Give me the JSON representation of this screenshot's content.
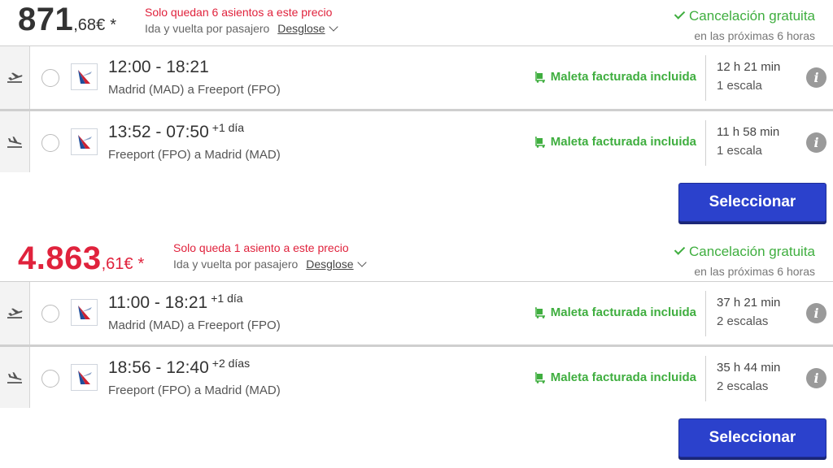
{
  "offers": [
    {
      "price_int": "871",
      "price_dec": ",68",
      "currency": "€",
      "star": "*",
      "seats_left": "Solo quedan 6 asientos a este precio",
      "fare_note": "Ida y vuelta por pasajero",
      "breakdown_link": "Desglose",
      "cancel_label": "Cancelación gratuita",
      "cancel_sub": "en las próximas 6 horas",
      "segments": [
        {
          "times": "12:00 - 18:21",
          "plus_day": "",
          "route": "Madrid (MAD) a Freeport (FPO)",
          "baggage": "Maleta facturada incluida",
          "duration": "12 h 21 min",
          "stops": "1 escala"
        },
        {
          "times": "13:52 - 07:50",
          "plus_day": "+1 día",
          "route": "Freeport (FPO) a Madrid (MAD)",
          "baggage": "Maleta facturada incluida",
          "duration": "11 h 58 min",
          "stops": "1 escala"
        }
      ],
      "select_label": "Seleccionar"
    },
    {
      "price_int": "4.863",
      "price_dec": ",61",
      "currency": "€",
      "star": "*",
      "seats_left": "Solo queda 1 asiento a este precio",
      "fare_note": "Ida y vuelta por pasajero",
      "breakdown_link": "Desglose",
      "cancel_label": "Cancelación gratuita",
      "cancel_sub": "en las próximas 6 horas",
      "segments": [
        {
          "times": "11:00 - 18:21",
          "plus_day": "+1 día",
          "route": "Madrid (MAD) a Freeport (FPO)",
          "baggage": "Maleta facturada incluida",
          "duration": "37 h 21 min",
          "stops": "2 escalas"
        },
        {
          "times": "18:56 - 12:40",
          "plus_day": "+2 días",
          "route": "Freeport (FPO) a Madrid (MAD)",
          "baggage": "Maleta facturada incluida",
          "duration": "35 h 44 min",
          "stops": "2 escalas"
        }
      ],
      "select_label": "Seleccionar"
    }
  ],
  "colors": {
    "price_alert": "#e0223c",
    "green": "#3fae3f",
    "select_button": "#2b41cc",
    "info_icon": "#9a9a9a"
  },
  "icons": {
    "outbound": "plane-takeoff-icon",
    "return": "plane-landing-icon",
    "airline": "american-airlines-logo-icon",
    "baggage": "luggage-cart-icon",
    "info": "info-icon",
    "check": "check-icon",
    "chevron": "chevron-down-icon"
  }
}
